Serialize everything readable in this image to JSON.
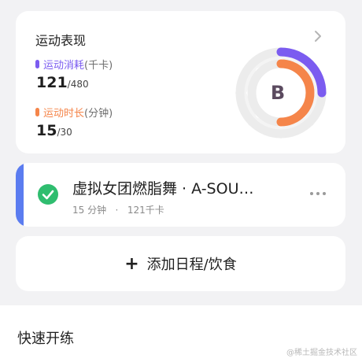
{
  "performance": {
    "title": "运动表现",
    "calories": {
      "label": "运动消耗",
      "unit": "(千卡)",
      "value": "121",
      "total": "/480",
      "color": "#7b5cf0"
    },
    "duration": {
      "label": "运动时长",
      "unit": "(分钟)",
      "value": "15",
      "total": "/30",
      "color": "#f5854a"
    },
    "grade": "B",
    "calories_fraction": 0.25,
    "duration_fraction": 0.5
  },
  "workout": {
    "title": "虚拟女团燃脂舞 · A-SOU…",
    "duration": "15 分钟",
    "separator": "·",
    "calories": "121千卡",
    "accent_color": "#5b7cf0",
    "check_color": "#2fbd6f"
  },
  "add_action": {
    "label": "添加日程/饮食"
  },
  "quick_start": {
    "title": "快速开练"
  },
  "watermark": "@稀土掘金技术社区"
}
